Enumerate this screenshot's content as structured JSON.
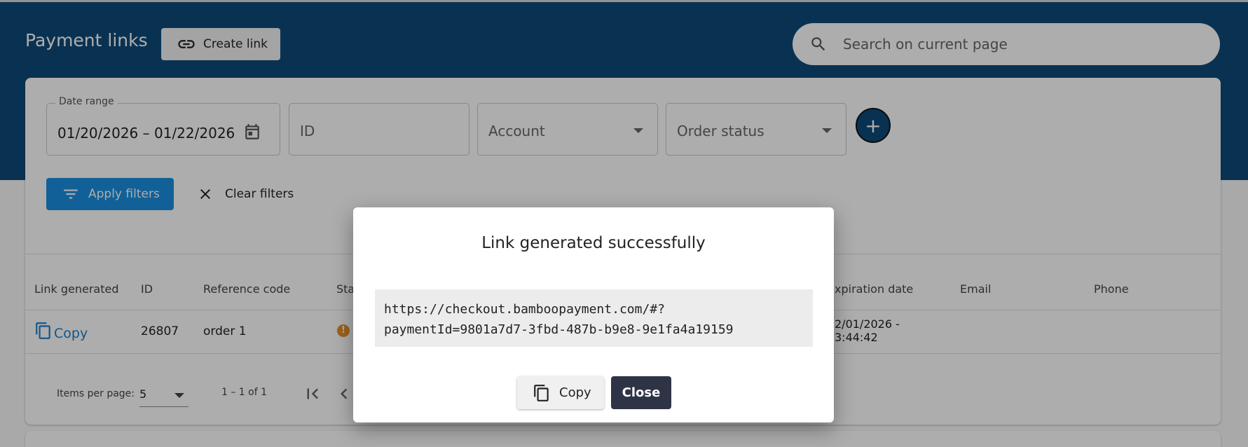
{
  "colors": {
    "header_bg": "#0e4b7a",
    "primary": "#1a8fe0",
    "link": "#1a7fcc",
    "warning": "#e8912c",
    "dialog_close_bg": "#2e3346"
  },
  "header": {
    "title": "Payment links",
    "create_button": "Create link",
    "search_placeholder": "Search on current page"
  },
  "filters": {
    "date_range_label": "Date range",
    "date_range_value": "01/20/2026 – 01/22/2026",
    "id_placeholder": "ID",
    "account_placeholder": "Account",
    "order_status_placeholder": "Order status",
    "add_icon": "+",
    "apply_label": "Apply filters",
    "clear_label": "Clear filters"
  },
  "table": {
    "columns": [
      "Link generated",
      "ID",
      "Reference code",
      "Sta",
      "xpiration date",
      "Email",
      "Phone"
    ],
    "row": {
      "copy_label": "Copy",
      "id": "26807",
      "reference_code": "order 1",
      "status_icon": "!",
      "expiration_line1": "2/01/2026 -",
      "expiration_line2": "3:44:42"
    }
  },
  "paginator": {
    "items_label": "Items per page:",
    "page_size": "5",
    "range": "1 – 1 of 1"
  },
  "dialog": {
    "title": "Link generated successfully",
    "url_line1": "https://checkout.bamboopayment.com/#?",
    "url_line2": "paymentId=9801a7d7-3fbd-487b-b9e8-9e1fa4a19159",
    "copy_label": "Copy",
    "close_label": "Close"
  }
}
